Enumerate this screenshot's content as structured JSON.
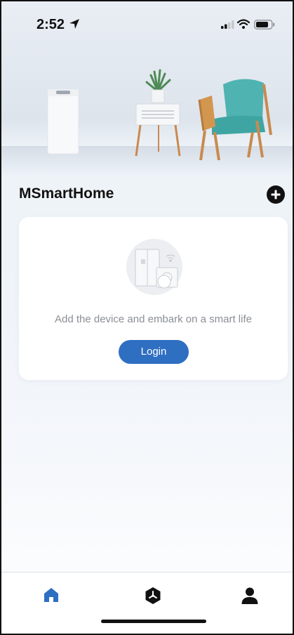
{
  "status_bar": {
    "time": "2:52",
    "icons": [
      "location-arrow-icon",
      "signal-icon",
      "wifi-icon",
      "battery-icon"
    ]
  },
  "header": {
    "title": "MSmartHome",
    "add_icon": "plus-circle-icon"
  },
  "empty_card": {
    "illustration": "smart-appliances-illustration",
    "message": "Add the device and embark on a smart life",
    "login_label": "Login"
  },
  "tab_bar": {
    "items": [
      {
        "icon": "home-icon",
        "active": true
      },
      {
        "icon": "hexagon-fan-icon",
        "active": false
      },
      {
        "icon": "person-icon",
        "active": false
      }
    ]
  },
  "colors": {
    "accent": "#2f6fc2",
    "background": "#eef3f9",
    "chair": "#4fb3b1",
    "wood": "#c98a4f",
    "text_muted": "#8b8f95"
  }
}
